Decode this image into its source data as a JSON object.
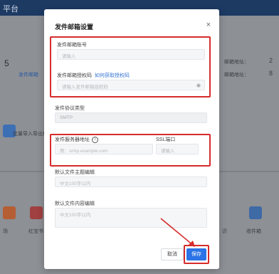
{
  "background": {
    "header_title": "平台",
    "left_side_row1": "5",
    "left_side_link": "发件邮箱",
    "right_side_row1_label": "邮箱地址：",
    "right_side_row1_value": "2",
    "right_side_row2_label": "邮箱地址：",
    "right_side_row2_value": "8",
    "left_callout": "批量导入导出统…",
    "bottom_left_label": "场",
    "bottom_left_label2": "红宝书",
    "bottom_right_label1": "识",
    "bottom_right_label2": "收件箱"
  },
  "modal": {
    "title": "发件邮箱设置",
    "close_icon": "×",
    "email_account": {
      "label": "发件邮箱账号",
      "placeholder": "请输入"
    },
    "auth_code": {
      "label": "发件邮箱授权码",
      "help_link": "如何获取授权码",
      "placeholder": "请输入发件邮箱授权码"
    },
    "protocol": {
      "label": "发件协议类型",
      "value": "SMTP"
    },
    "server": {
      "label": "发件服务器地址",
      "placeholder": "例：smtp.example.com"
    },
    "ssl_port": {
      "label": "SSL端口",
      "placeholder": "请输入"
    },
    "default_subject": {
      "label": "默认文件主题编辑",
      "placeholder": "中文100字以内"
    },
    "default_content": {
      "label": "默认文件内容编辑",
      "placeholder": "中文100字以内"
    },
    "cancel_label": "取消",
    "save_label": "保存"
  },
  "colors": {
    "accent": "#2b73e6",
    "highlight": "#d62b2b"
  }
}
